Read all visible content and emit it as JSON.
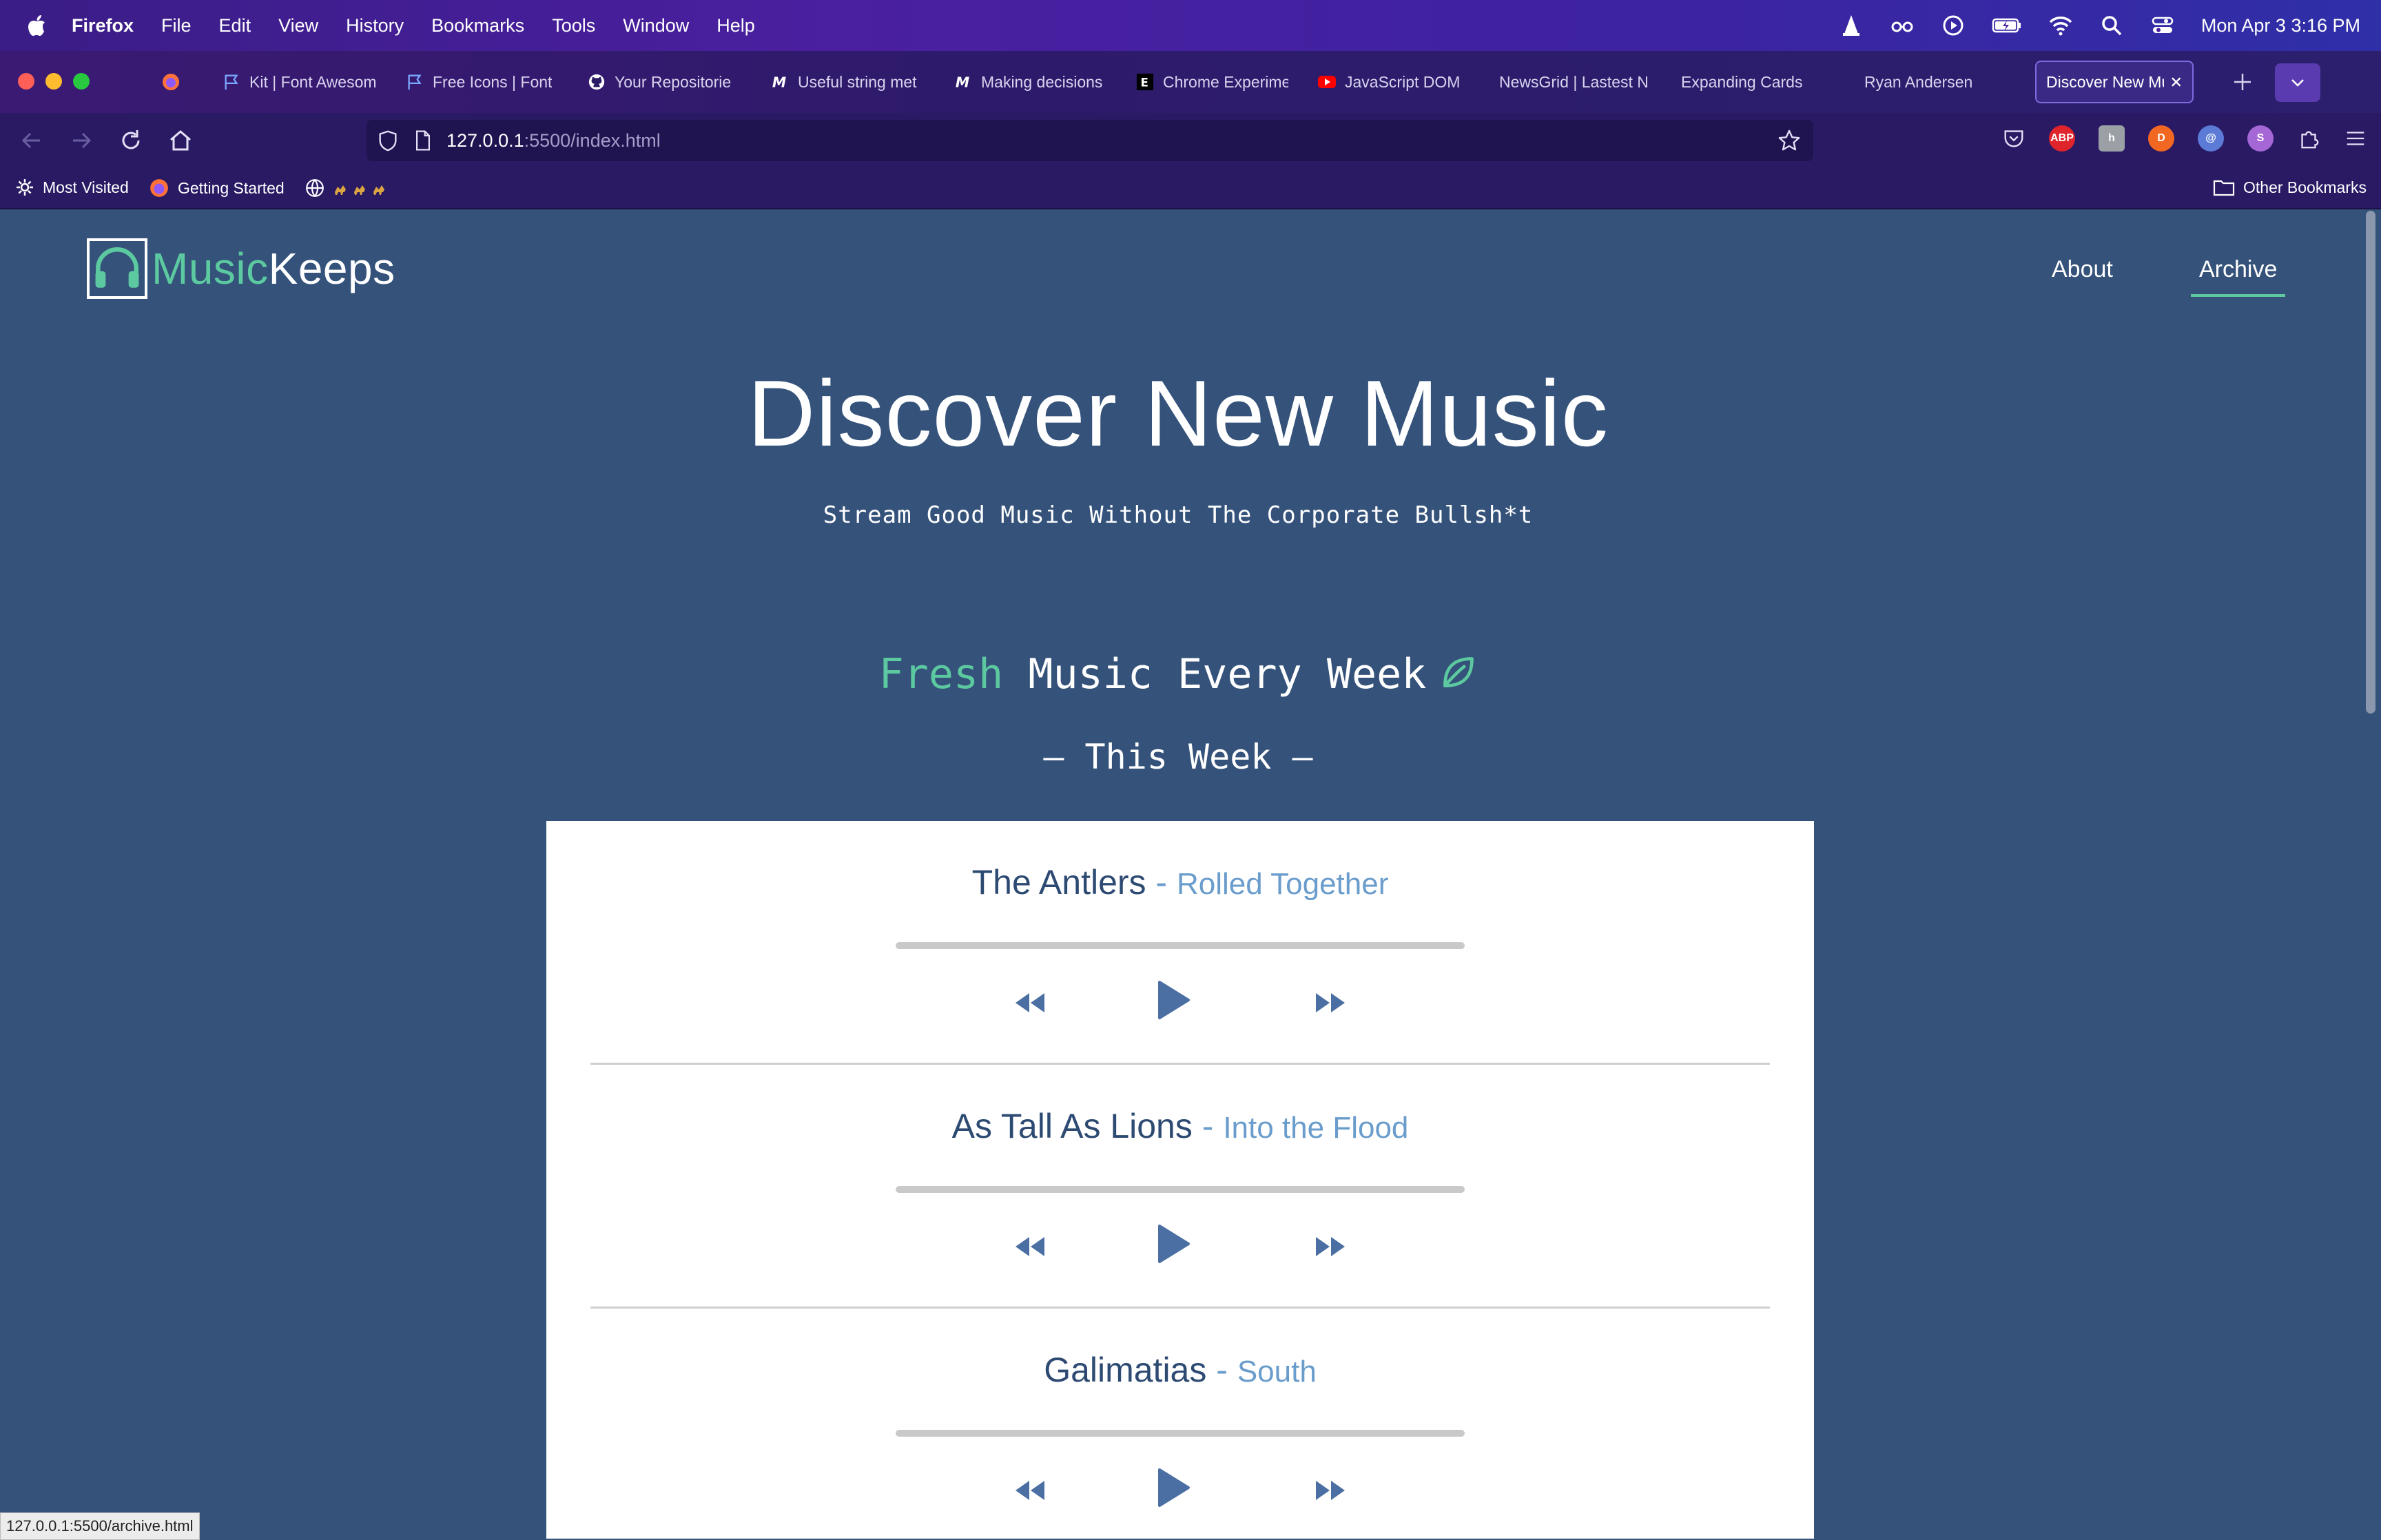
{
  "menubar": {
    "app": "Firefox",
    "items": [
      "File",
      "Edit",
      "View",
      "History",
      "Bookmarks",
      "Tools",
      "Window",
      "Help"
    ],
    "datetime": "Mon Apr 3  3:16 PM"
  },
  "tabs": [
    {
      "label": "Kit | Font Awesom",
      "icon": "flag-icon"
    },
    {
      "label": "Free Icons | Font",
      "icon": "flag-icon"
    },
    {
      "label": "Your Repositorie",
      "icon": "github-icon"
    },
    {
      "label": "Useful string met",
      "icon": "mdn-icon"
    },
    {
      "label": "Making decisions",
      "icon": "mdn-icon"
    },
    {
      "label": "Chrome Experime",
      "icon": "e-icon"
    },
    {
      "label": "JavaScript DOM",
      "icon": "youtube-icon"
    },
    {
      "label": "NewsGrid | Lastest N",
      "icon": ""
    },
    {
      "label": "Expanding Cards",
      "icon": ""
    },
    {
      "label": "Ryan Andersen",
      "icon": ""
    },
    {
      "label": "Discover New Mus",
      "icon": "",
      "active": true
    }
  ],
  "urlbar": {
    "host": "127.0.0.1",
    "path": ":5500/index.html"
  },
  "bookmarks": {
    "most_visited": "Most Visited",
    "getting_started": "Getting Started",
    "other": "Other Bookmarks"
  },
  "site": {
    "logo_music": "Music",
    "logo_keeps": "Keeps",
    "nav_about": "About",
    "nav_archive": "Archive",
    "hero_title": "Discover New Music",
    "hero_subtitle": "Stream Good Music Without The Corporate Bullsh*t",
    "fresh_word": "Fresh",
    "fresh_rest": " Music Every Week",
    "week_label": "— This Week —"
  },
  "songs": [
    {
      "artist": "The Antlers",
      "sep": " - ",
      "track": "Rolled Together"
    },
    {
      "artist": "As Tall As Lions",
      "sep": " - ",
      "track": "Into the Flood"
    },
    {
      "artist": "Galimatias",
      "sep": " - ",
      "track": "South"
    }
  ],
  "status_url": "127.0.0.1:5500/archive.html",
  "colors": {
    "accent": "#5cc9a0",
    "page_bg": "#34527a",
    "title_blue": "#2d4a72",
    "track_blue": "#6a9ccc",
    "control_blue": "#4b6fa3"
  }
}
